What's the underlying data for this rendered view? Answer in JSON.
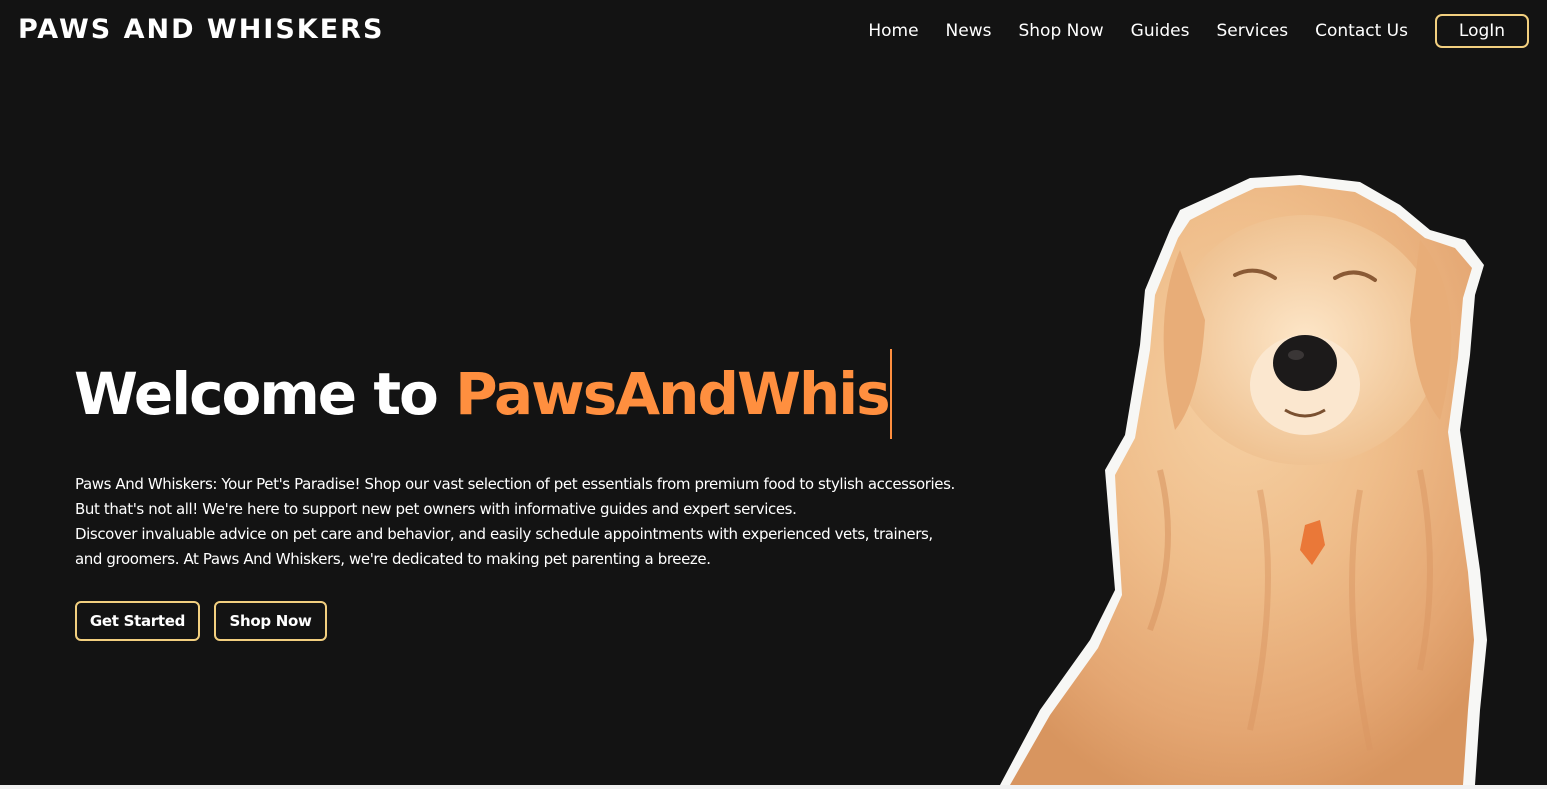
{
  "header": {
    "brand": "PAWS AND WHISKERS",
    "nav": [
      "Home",
      "News",
      "Shop Now",
      "Guides",
      "Services",
      "Contact Us"
    ],
    "login_label": "LogIn"
  },
  "hero": {
    "title_prefix": "Welcome to ",
    "title_typed": "PawsAndWhis",
    "description_lines": [
      "Paws And Whiskers: Your Pet's Paradise! Shop our vast selection of pet essentials from premium food to stylish accessories.",
      "But that's not all! We're here to support new pet owners with informative guides and expert services.",
      "Discover invaluable advice on pet care and behavior, and easily schedule appointments with experienced vets, trainers,",
      "and groomers. At Paws And Whiskers, we're dedicated to making pet parenting a breeze."
    ],
    "buttons": {
      "get_started": "Get Started",
      "shop_now": "Shop Now"
    },
    "image": "golden-retriever-dog"
  },
  "colors": {
    "background": "#131313",
    "accent_orange": "#ff8f3f",
    "button_border": "#f2cf7f",
    "text": "#ffffff"
  }
}
